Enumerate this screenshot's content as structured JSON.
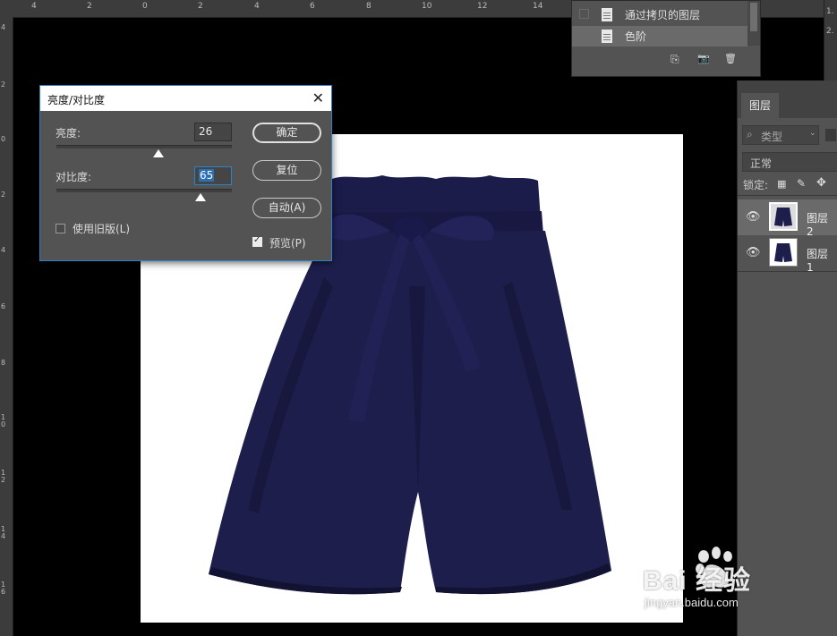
{
  "ruler": {
    "top_labels": [
      "4",
      "2",
      "0",
      "2",
      "4",
      "6",
      "8",
      "10",
      "12",
      "14"
    ],
    "left_labels": [
      "4",
      "2",
      "0",
      "2",
      "4",
      "6",
      "8",
      "1 0",
      "1 2",
      "1 4",
      "1 6"
    ]
  },
  "history": {
    "items": [
      {
        "label": "通过拷贝的图层"
      },
      {
        "label": "色阶"
      }
    ],
    "tools": {
      "new_snapshot": "⎘",
      "camera": "📷",
      "trash": "🗑"
    }
  },
  "layers_panel": {
    "tab": "图层",
    "filter_kind": "类型",
    "blend_mode": "正常",
    "lock_label": "锁定:",
    "layers": [
      {
        "name": "图层 2",
        "selected": true
      },
      {
        "name": "图层 1",
        "selected": false
      }
    ]
  },
  "right_strip": {
    "label_1": "1.",
    "label_2": "2."
  },
  "dialog": {
    "title": "亮度/对比度",
    "brightness_label": "亮度:",
    "brightness_value": "26",
    "contrast_label": "对比度:",
    "contrast_value": "65",
    "legacy_label": "使用旧版(L)",
    "legacy_checked": false,
    "ok_label": "确定",
    "reset_label": "复位",
    "auto_label": "自动(A)",
    "preview_label": "预览(P)",
    "preview_checked": true
  },
  "watermark": {
    "logo_text": "Bai 经验",
    "url": "jingyan.baidu.com"
  },
  "colors": {
    "accent": "#2b82c9",
    "panel": "#535353",
    "shorts": "#1c1c4a"
  }
}
